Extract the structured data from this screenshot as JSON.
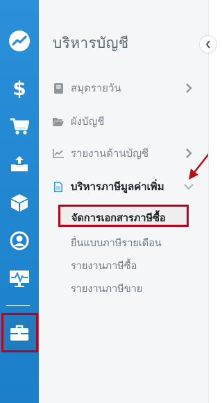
{
  "panel": {
    "title": "บริหารบัญชี",
    "items": [
      {
        "label": "สมุดรายวัน",
        "icon": "book-icon",
        "has_chevron": true
      },
      {
        "label": "ผังบัญชี",
        "icon": "folder-icon",
        "has_chevron": false
      },
      {
        "label": "รายงานด้านบัญชี",
        "icon": "chart-icon",
        "has_chevron": true
      },
      {
        "label": "บริหารภาษีมูลค่าเพิ่ม",
        "icon": "document-icon",
        "has_chevron": true,
        "active": true
      }
    ],
    "subitems": [
      {
        "label": "จัดการเอกสารภาษีซื้อ",
        "active": true
      },
      {
        "label": "ยื่นแบบภาษีรายเดือน"
      },
      {
        "label": "รายงานภาษีซื้อ"
      },
      {
        "label": "รายงานภาษีขาย"
      }
    ]
  },
  "rail": {
    "items": [
      "trend-logo-icon",
      "dollar-icon",
      "cart-icon",
      "tray-upload-icon",
      "box-icon",
      "user-circle-icon",
      "monitor-pulse-icon",
      "briefcase-icon"
    ],
    "active": "briefcase-icon"
  },
  "colors": {
    "rail": "#2b90d9",
    "highlight": "#c0001a",
    "panel_bg": "#f4f6f8",
    "text_muted": "#7b848b",
    "text_active": "#1e2327"
  }
}
